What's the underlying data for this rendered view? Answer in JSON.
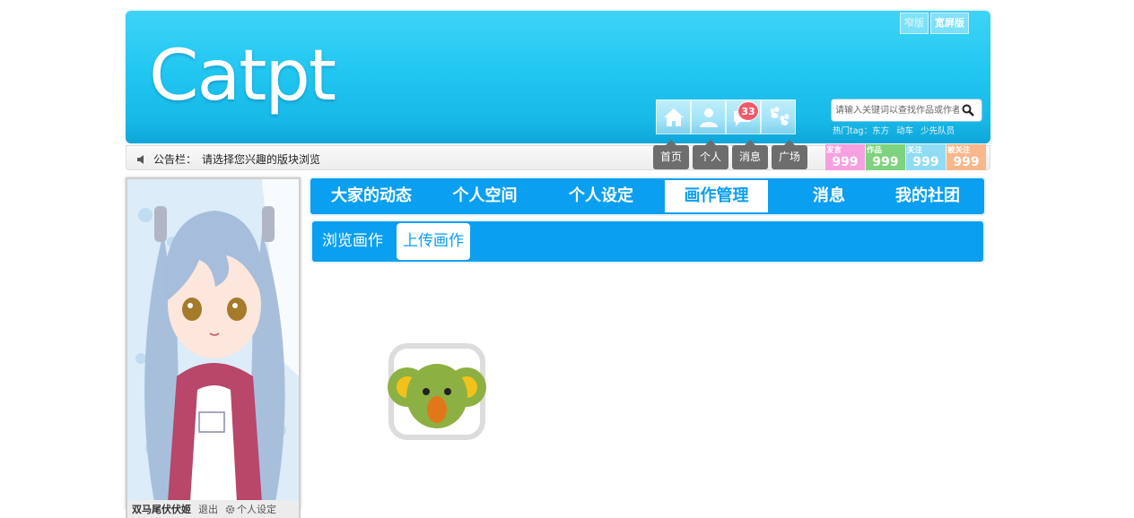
{
  "header": {
    "logo": "Catpt",
    "version_switch": [
      "窄版",
      "宽屏版"
    ],
    "nav_icons": [
      {
        "name": "home-icon"
      },
      {
        "name": "person-icon"
      },
      {
        "name": "message-icon",
        "badge": "33"
      },
      {
        "name": "paw-icon"
      }
    ],
    "search": {
      "placeholder": "请输入关键词以查找作品或作者"
    },
    "hot_tags": {
      "label": "热门tag：",
      "items": [
        "东方",
        "动车",
        "少先队员"
      ]
    }
  },
  "notice": {
    "label": "公告栏：",
    "text": "请选择您兴趣的版块浏览"
  },
  "nav_tabs": [
    "首页",
    "个人",
    "消息",
    "广场"
  ],
  "stats": [
    {
      "label": "发言",
      "value": "999",
      "color": "#f7a0e0"
    },
    {
      "label": "作品",
      "value": "999",
      "color": "#7ed37e"
    },
    {
      "label": "关注",
      "value": "999",
      "color": "#8fdcf4"
    },
    {
      "label": "被关注",
      "value": "999",
      "color": "#f8b88c"
    }
  ],
  "user": {
    "name": "双马尾伏伏姬",
    "logout": "退出",
    "settings": "个人设定"
  },
  "main_menu": [
    "大家的动态",
    "个人空间",
    "个人设定",
    "画作管理",
    "消息",
    "我的社团"
  ],
  "main_menu_active": "画作管理",
  "sub_menu": [
    "浏览画作",
    "上传画作"
  ],
  "sub_menu_active": "上传画作",
  "colors": {
    "primary": "#0a9ff0",
    "header": "#22c7f1",
    "badge": "#ef5a6a"
  }
}
